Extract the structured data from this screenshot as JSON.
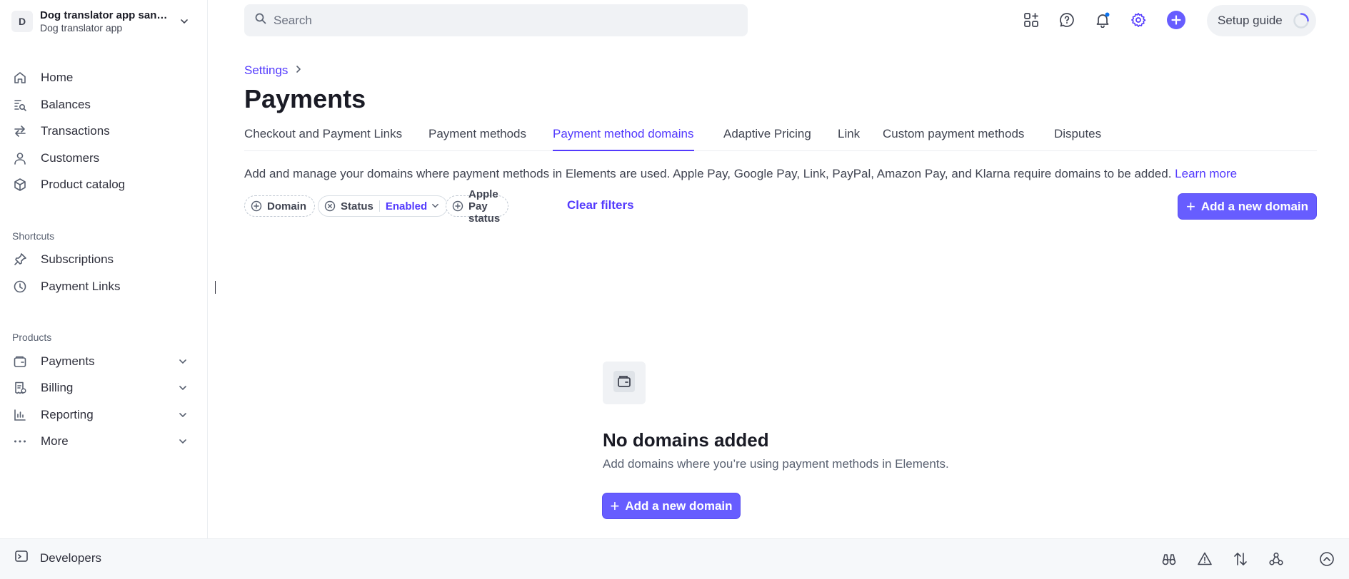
{
  "account": {
    "initial": "D",
    "name": "Dog translator app sand...",
    "sub": "Dog translator app"
  },
  "sidebar": {
    "items": [
      {
        "label": "Home",
        "icon": "home-icon"
      },
      {
        "label": "Balances",
        "icon": "balances-icon"
      },
      {
        "label": "Transactions",
        "icon": "transactions-icon"
      },
      {
        "label": "Customers",
        "icon": "customers-icon"
      },
      {
        "label": "Product catalog",
        "icon": "product-catalog-icon"
      }
    ],
    "shortcuts_label": "Shortcuts",
    "shortcuts": [
      {
        "label": "Subscriptions",
        "icon": "pin-icon"
      },
      {
        "label": "Payment Links",
        "icon": "clock-icon"
      }
    ],
    "products_label": "Products",
    "products": [
      {
        "label": "Payments",
        "icon": "payments-icon"
      },
      {
        "label": "Billing",
        "icon": "billing-icon"
      },
      {
        "label": "Reporting",
        "icon": "reporting-icon"
      },
      {
        "label": "More",
        "icon": "more-icon"
      }
    ]
  },
  "topbar": {
    "search_placeholder": "Search",
    "setup_guide": "Setup guide"
  },
  "breadcrumb": {
    "settings": "Settings"
  },
  "page": {
    "title": "Payments"
  },
  "tabs": [
    {
      "label": "Checkout and Payment Links",
      "active": false
    },
    {
      "label": "Payment methods",
      "active": false
    },
    {
      "label": "Payment method domains",
      "active": true
    },
    {
      "label": "Adaptive Pricing",
      "active": false
    },
    {
      "label": "Link",
      "active": false
    },
    {
      "label": "Custom payment methods",
      "active": false
    },
    {
      "label": "Disputes",
      "active": false
    }
  ],
  "description": {
    "text": "Add and manage your domains where payment methods in Elements are used. Apple Pay, Google Pay, Link, PayPal, Amazon Pay, and Klarna require domains to be added. ",
    "learn_more": "Learn more"
  },
  "filters": {
    "domain": "Domain",
    "status": "Status",
    "status_value": "Enabled",
    "apple_pay_status": "Apple Pay status",
    "clear": "Clear filters"
  },
  "actions": {
    "add_domain": "Add a new domain"
  },
  "empty_state": {
    "title": "No domains added",
    "subtitle": "Add domains where you’re using payment methods in Elements.",
    "button": "Add a new domain"
  },
  "devbar": {
    "label": "Developers"
  },
  "colors": {
    "accent": "#533afd",
    "button": "#675dff",
    "notification_dot": "#0a72ef"
  }
}
